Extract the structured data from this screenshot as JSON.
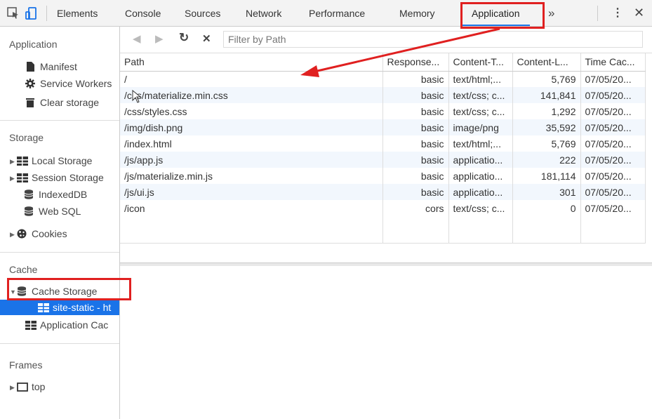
{
  "tabs": [
    {
      "label": "Elements"
    },
    {
      "label": "Console"
    },
    {
      "label": "Sources"
    },
    {
      "label": "Network"
    },
    {
      "label": "Performance"
    },
    {
      "label": "Memory"
    },
    {
      "label": "Application"
    }
  ],
  "more_tabs_label": "»",
  "sidebar": {
    "application": {
      "heading": "Application",
      "items": [
        {
          "label": "Manifest"
        },
        {
          "label": "Service Workers"
        },
        {
          "label": "Clear storage"
        }
      ]
    },
    "storage": {
      "heading": "Storage",
      "items": [
        {
          "label": "Local Storage"
        },
        {
          "label": "Session Storage"
        },
        {
          "label": "IndexedDB"
        },
        {
          "label": "Web SQL"
        },
        {
          "label": "Cookies"
        }
      ]
    },
    "cache": {
      "heading": "Cache",
      "items": [
        {
          "label": "Cache Storage"
        },
        {
          "label": "site-static - ht"
        },
        {
          "label": "Application Cac"
        }
      ]
    },
    "frames": {
      "heading": "Frames",
      "items": [
        {
          "label": "top"
        }
      ]
    }
  },
  "filter": {
    "placeholder": "Filter by Path",
    "value": ""
  },
  "table": {
    "headers": [
      "Path",
      "Response...",
      "Content-T...",
      "Content-L...",
      "Time Cac..."
    ],
    "rows": [
      [
        "/",
        "basic",
        "text/html;...",
        "5,769",
        "07/05/20..."
      ],
      [
        "/css/materialize.min.css",
        "basic",
        "text/css; c...",
        "141,841",
        "07/05/20..."
      ],
      [
        "/css/styles.css",
        "basic",
        "text/css; c...",
        "1,292",
        "07/05/20..."
      ],
      [
        "/img/dish.png",
        "basic",
        "image/png",
        "35,592",
        "07/05/20..."
      ],
      [
        "/index.html",
        "basic",
        "text/html;...",
        "5,769",
        "07/05/20..."
      ],
      [
        "/js/app.js",
        "basic",
        "applicatio...",
        "222",
        "07/05/20..."
      ],
      [
        "/js/materialize.min.js",
        "basic",
        "applicatio...",
        "181,114",
        "07/05/20..."
      ],
      [
        "/js/ui.js",
        "basic",
        "applicatio...",
        "301",
        "07/05/20..."
      ],
      [
        "/icon",
        "cors",
        "text/css; c...",
        "0",
        "07/05/20..."
      ]
    ]
  },
  "colors": {
    "accent": "#1a73e8",
    "annotation": "#e02020"
  }
}
